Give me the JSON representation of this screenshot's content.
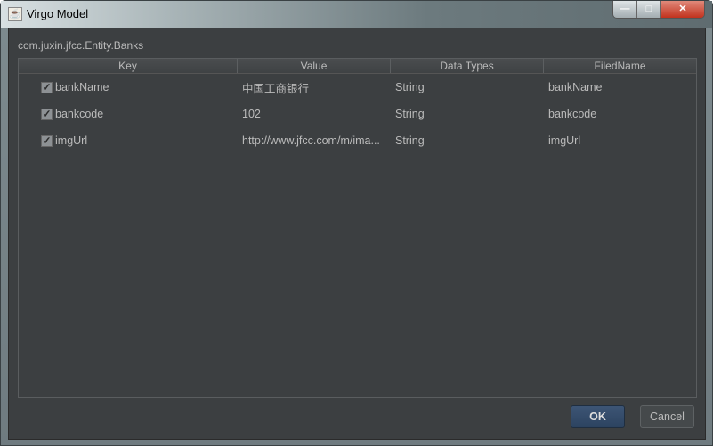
{
  "window": {
    "title": "Virgo Model",
    "minimize": "—",
    "maximize": "□",
    "close": "✕"
  },
  "entity": "com.juxin.jfcc.Entity.Banks",
  "table": {
    "headers": [
      "Key",
      "Value",
      "Data Types",
      "FiledName"
    ],
    "rows": [
      {
        "checked": true,
        "key": "bankName",
        "value": "中国工商银行",
        "type": "String",
        "field": "bankName"
      },
      {
        "checked": true,
        "key": "bankcode",
        "value": "102",
        "type": "String",
        "field": "bankcode"
      },
      {
        "checked": true,
        "key": "imgUrl",
        "value": "http://www.jfcc.com/m/ima...",
        "type": "String",
        "field": "imgUrl"
      }
    ]
  },
  "buttons": {
    "ok": "OK",
    "cancel": "Cancel"
  }
}
